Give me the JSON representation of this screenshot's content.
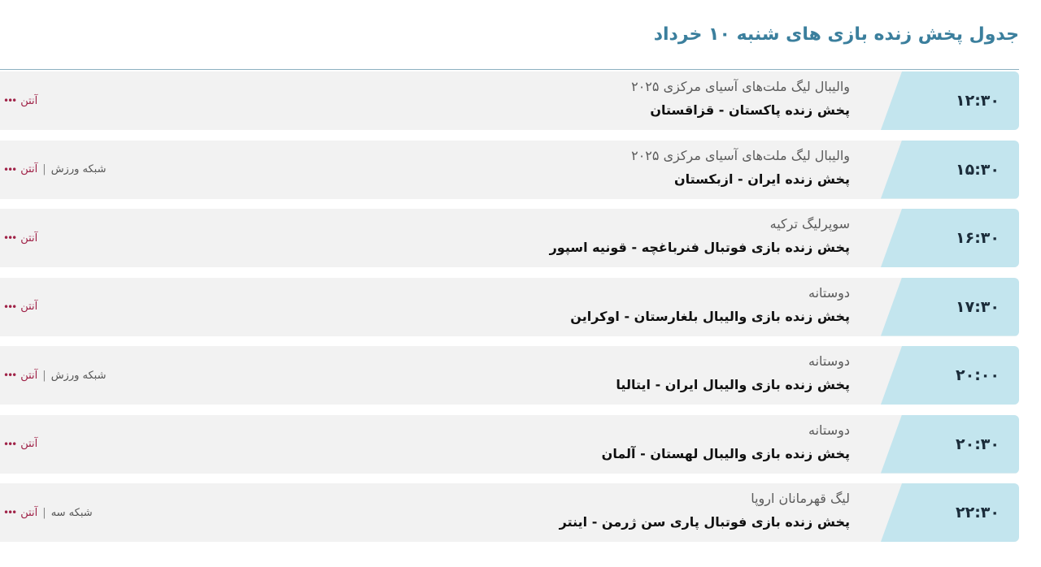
{
  "page": {
    "title": "جدول پخش زنده بازی های شنبه ۱۰ خرداد"
  },
  "colors": {
    "title": "#3b7f9d",
    "time_cell": "#c3e5ee",
    "row_background": "#f2f2f2",
    "antenna_link": "#a02348"
  },
  "schedule": [
    {
      "time": "۱۲:۳۰",
      "league": "والیبال لیگ ملت‌های آسیای مرکزی ۲۰۲۵",
      "match": "پخش زنده پاکستان - قزاقستان",
      "antenna": "آنتن",
      "network": "",
      "dots_icon": "•••"
    },
    {
      "time": "۱۵:۳۰",
      "league": "والیبال لیگ ملت‌های آسیای مرکزی ۲۰۲۵",
      "match": "پخش زنده ایران - ازبکستان",
      "antenna": "آنتن",
      "network": "شبکه ورزش",
      "dots_icon": "•••"
    },
    {
      "time": "۱۶:۳۰",
      "league": "سوپرلیگ ترکیه",
      "match": "پخش زنده بازی فوتبال فنرباغچه - قونیه اسپور",
      "antenna": "آنتن",
      "network": "",
      "dots_icon": "•••"
    },
    {
      "time": "۱۷:۳۰",
      "league": "دوستانه",
      "match": "پخش زنده بازی والیبال بلغارستان - اوکراین",
      "antenna": "آنتن",
      "network": "",
      "dots_icon": "•••"
    },
    {
      "time": "۲۰:۰۰",
      "league": "دوستانه",
      "match": "پخش زنده بازی والیبال ایران - ایتالیا",
      "antenna": "آنتن",
      "network": "شبکه ورزش",
      "dots_icon": "•••"
    },
    {
      "time": "۲۰:۳۰",
      "league": "دوستانه",
      "match": "پخش زنده بازی والیبال لهستان - آلمان",
      "antenna": "آنتن",
      "network": "",
      "dots_icon": "•••"
    },
    {
      "time": "۲۲:۳۰",
      "league": "لیگ قهرمانان اروپا",
      "match": "پخش زنده بازی فوتبال پاری سن ژرمن - اینتر",
      "antenna": "آنتن",
      "network": "شبکه سه",
      "dots_icon": "•••"
    }
  ]
}
